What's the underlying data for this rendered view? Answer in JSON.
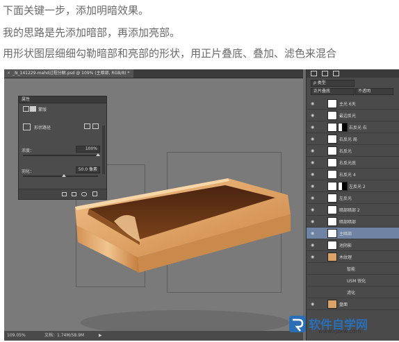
{
  "intro": {
    "line1": "下面关键一步，添加明暗效果。",
    "line2": "我的思路是先添加暗部，再添加亮部。",
    "line3": "用形状图层细细勾勒暗部和亮部的形状，用正片叠底、叠加、滤色来混合"
  },
  "document_tab": {
    "title": "_N_141229-mahd过程分解.psd @ 109% (主暗部, RGB/8) *",
    "close": "×"
  },
  "properties": {
    "title": "属性",
    "mask_label": "蒙版",
    "shape_label": "形状路径",
    "density_label": "浓度：",
    "density_value": "100%",
    "density_level": 1.0,
    "feather_label": "羽化：",
    "feather_value": "50.0 像素",
    "feather_level": 0.55
  },
  "status": {
    "zoom": "109.05%",
    "doc": "文档：1.74M/58.9M",
    "arrow": "▶"
  },
  "layers": {
    "filter_label": "ρ 类型",
    "blend_mode": "正片叠底",
    "opacity_label": "不透明",
    "items": [
      {
        "name": "主光 6天"
      },
      {
        "name": "最边反光"
      },
      {
        "name": "右反光 右"
      },
      {
        "name": "右反光 局"
      },
      {
        "name": "右反光"
      },
      {
        "name": "右反光底"
      },
      {
        "name": "右反光 4"
      },
      {
        "name": "左反光 2"
      },
      {
        "name": "左反光"
      },
      {
        "name": "暗部暗部 2"
      },
      {
        "name": "暗部暗部"
      },
      {
        "name": "主暗部"
      },
      {
        "name": "池阴影"
      },
      {
        "name": "木纹理"
      },
      {
        "name": "智能"
      },
      {
        "name": "USM 锐化"
      },
      {
        "name": "滤化"
      },
      {
        "name": "盘面"
      }
    ]
  },
  "watermark": {
    "brand": "软件自学网",
    "url": "www.rjzxw.com"
  },
  "colors": {
    "selected_layer": "#6f84a4",
    "wood_light": "#e7b27a",
    "wood_dark": "#5b2f14",
    "logo_blue": "#2a6fb6"
  }
}
